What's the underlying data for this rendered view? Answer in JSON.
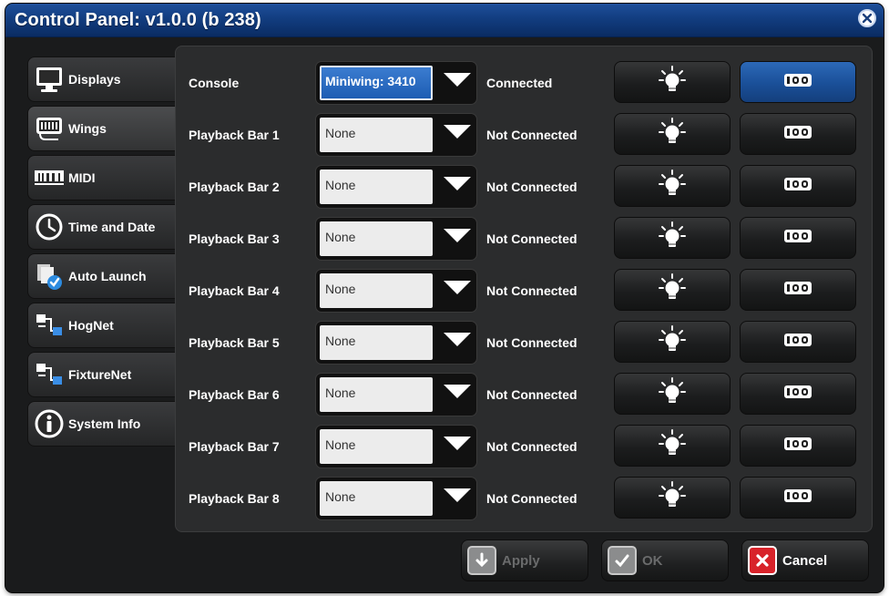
{
  "window": {
    "title": "Control Panel: v1.0.0 (b 238)"
  },
  "tabs": [
    {
      "label": "Displays",
      "icon": "monitor-icon"
    },
    {
      "label": "Wings",
      "icon": "wing-icon"
    },
    {
      "label": "MIDI",
      "icon": "midi-icon"
    },
    {
      "label": "Time and Date",
      "icon": "clock-icon"
    },
    {
      "label": "Auto Launch",
      "icon": "auto-launch-icon"
    },
    {
      "label": "HogNet",
      "icon": "network-icon"
    },
    {
      "label": "FixtureNet",
      "icon": "network-icon"
    },
    {
      "label": "System Info",
      "icon": "info-icon"
    }
  ],
  "active_tab": "Wings",
  "rows": [
    {
      "label": "Console",
      "device": "Miniwing: 3410",
      "status": "Connected",
      "selected": true
    },
    {
      "label": "Playback Bar 1",
      "device": "None",
      "status": "Not Connected",
      "selected": false
    },
    {
      "label": "Playback Bar 2",
      "device": "None",
      "status": "Not Connected",
      "selected": false
    },
    {
      "label": "Playback Bar 3",
      "device": "None",
      "status": "Not Connected",
      "selected": false
    },
    {
      "label": "Playback Bar 4",
      "device": "None",
      "status": "Not Connected",
      "selected": false
    },
    {
      "label": "Playback Bar 5",
      "device": "None",
      "status": "Not Connected",
      "selected": false
    },
    {
      "label": "Playback Bar 6",
      "device": "None",
      "status": "Not Connected",
      "selected": false
    },
    {
      "label": "Playback Bar 7",
      "device": "None",
      "status": "Not Connected",
      "selected": false
    },
    {
      "label": "Playback Bar 8",
      "device": "None",
      "status": "Not Connected",
      "selected": false
    }
  ],
  "footer": {
    "apply_label": "Apply",
    "ok_label": "OK",
    "cancel_label": "Cancel"
  },
  "colors": {
    "title_bar": "#123d80",
    "active_blue": "#1d5db3",
    "cancel_red": "#d8232a",
    "panel": "#2b2c2d"
  }
}
